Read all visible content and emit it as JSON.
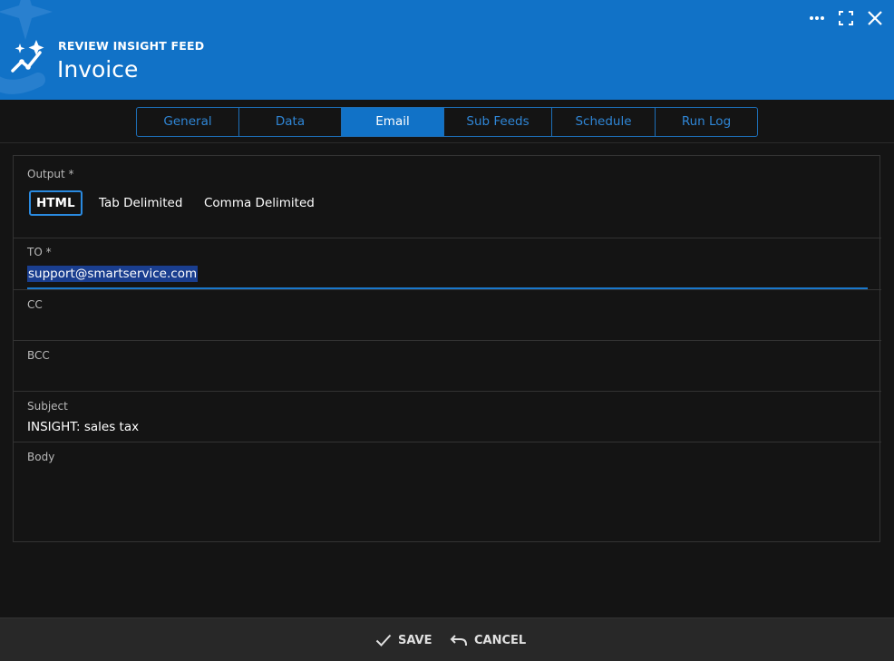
{
  "header": {
    "eyebrow": "REVIEW INSIGHT FEED",
    "title": "Invoice",
    "background_color": "#1172c7",
    "icons": [
      "insight-sparkle-icon",
      "more-icon",
      "maximize-icon",
      "close-icon"
    ]
  },
  "tabs": [
    {
      "label": "General",
      "active": false
    },
    {
      "label": "Data",
      "active": false
    },
    {
      "label": "Email",
      "active": true
    },
    {
      "label": "Sub Feeds",
      "active": false
    },
    {
      "label": "Schedule",
      "active": false
    },
    {
      "label": "Run Log",
      "active": false
    }
  ],
  "form": {
    "output": {
      "label": "Output *",
      "options": [
        "HTML",
        "Tab Delimited",
        "Comma Delimited"
      ],
      "selected": "HTML"
    },
    "to": {
      "label": "TO *",
      "value": "support@smartservice.com"
    },
    "cc": {
      "label": "CC",
      "value": ""
    },
    "bcc": {
      "label": "BCC",
      "value": ""
    },
    "subject": {
      "label": "Subject",
      "value": "INSIGHT: sales tax"
    },
    "body": {
      "label": "Body",
      "value": ""
    }
  },
  "footer": {
    "save_label": "SAVE",
    "cancel_label": "CANCEL",
    "icons": [
      "check-icon",
      "undo-icon"
    ]
  }
}
